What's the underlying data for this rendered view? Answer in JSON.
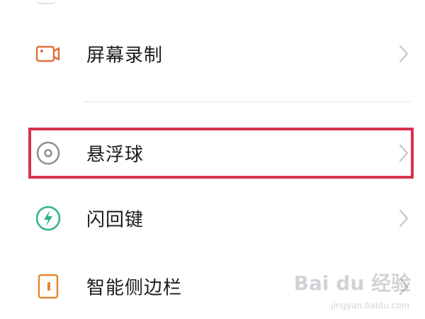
{
  "settings_list": {
    "items": [
      {
        "label": "屏幕录制",
        "icon": "screen-record-icon",
        "icon_color": "#e0703c"
      },
      {
        "label": "悬浮球",
        "icon": "floating-ball-icon",
        "icon_color": "#8a8f98"
      },
      {
        "label": "闪回键",
        "icon": "flashback-key-icon",
        "icon_color": "#2fb38a"
      },
      {
        "label": "智能侧边栏",
        "icon": "smart-sidebar-icon",
        "icon_color": "#e8842c"
      }
    ],
    "chevron_icon": "chevron-right-icon",
    "chevron_color": "#c7c7c7"
  },
  "highlight": {
    "color": "#d6334f"
  },
  "watermark": {
    "main_text": "Bai du 经验",
    "sub_text": "jingyan.baidu.com"
  }
}
